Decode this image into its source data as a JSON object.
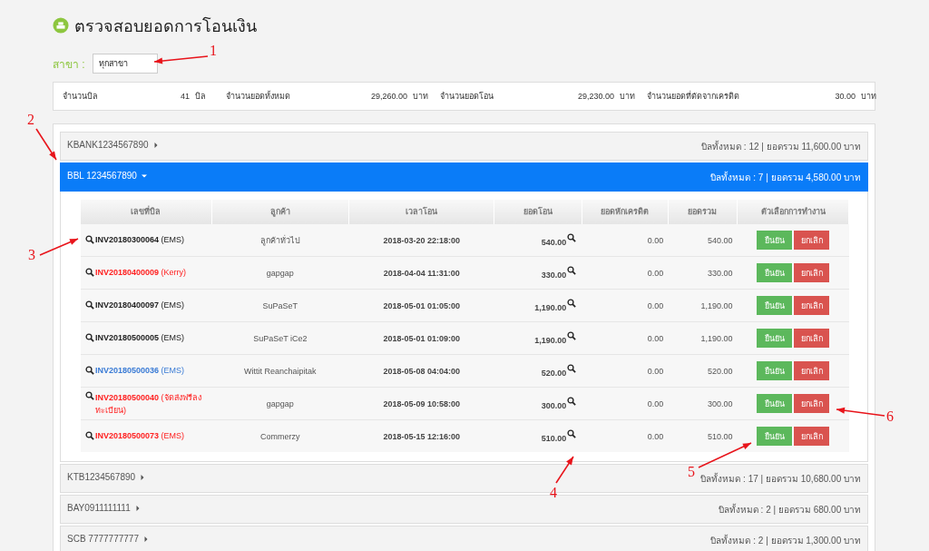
{
  "page": {
    "title": "ตรวจสอบยอดการโอนเงิน"
  },
  "branch": {
    "label": "สาขา :",
    "value": "ทุกสาขา"
  },
  "summary": [
    {
      "label": "จำนวนบิล",
      "value": "41",
      "unit": "บิล"
    },
    {
      "label": "จำนวนยอดทั้งหมด",
      "value": "29,260.00",
      "unit": "บาท"
    },
    {
      "label": "จำนวนยอดโอน",
      "value": "29,230.00",
      "unit": "บาท"
    },
    {
      "label": "จำนวนยอดที่ตัดจากเครดิต",
      "value": "30.00",
      "unit": "บาท"
    }
  ],
  "accounts": [
    {
      "name": "KBANK1234567890",
      "expanded": false,
      "totals": "บิลทั้งหมด : 12 | ยอดรวม 11,600.00 บาท"
    },
    {
      "name": "BBL 1234567890",
      "expanded": true,
      "totals": "บิลทั้งหมด : 7 | ยอดรวม 4,580.00 บาท",
      "table": {
        "columns": [
          "เลขที่บิล",
          "ลูกค้า",
          "เวลาโอน",
          "ยอดโอน",
          "ยอดหักเครดิต",
          "ยอดรวม",
          "ตัวเลือกการทำงาน"
        ],
        "rows": [
          {
            "bill": "**INV20180300064** (EMS)",
            "color": "#222222",
            "customer": "ลูกค้าทั่วไป",
            "time": "2018-03-20 22:18:00",
            "amount": "540.00",
            "credit": "0.00",
            "total": "540.00",
            "actions": [
              {
                "kind": "confirm",
                "label": "ยืนยัน"
              },
              {
                "kind": "cancel",
                "label": "ยกเลิก"
              }
            ]
          },
          {
            "bill": "**INV20180400009** (Kerry)",
            "color": "#ff2020",
            "customer": "gapgap",
            "time": "2018-04-04 11:31:00",
            "amount": "330.00",
            "credit": "0.00",
            "total": "330.00",
            "actions": [
              {
                "kind": "confirm",
                "label": "ยืนยัน"
              },
              {
                "kind": "cancel",
                "label": "ยกเลิก"
              }
            ]
          },
          {
            "bill": "**INV20180400097** (EMS)",
            "color": "#222222",
            "customer": "SuPaSeT",
            "time": "2018-05-01 01:05:00",
            "amount": "1,190.00",
            "credit": "0.00",
            "total": "1,190.00",
            "actions": [
              {
                "kind": "confirm",
                "label": "ยืนยัน"
              },
              {
                "kind": "cancel",
                "label": "ยกเลิก"
              }
            ]
          },
          {
            "bill": "**INV20180500005** (EMS)",
            "color": "#222222",
            "customer": "SuPaSeT iCe2",
            "time": "2018-05-01 01:09:00",
            "amount": "1,190.00",
            "credit": "0.00",
            "total": "1,190.00",
            "actions": [
              {
                "kind": "confirm",
                "label": "ยืนยัน"
              },
              {
                "kind": "cancel",
                "label": "ยกเลิก"
              }
            ]
          },
          {
            "bill": "**INV20180500036** (EMS)",
            "color": "#3a7bd5",
            "customer": "Wittit Reanchaipitak",
            "time": "2018-05-08 04:04:00",
            "amount": "520.00",
            "credit": "0.00",
            "total": "520.00",
            "actions": [
              {
                "kind": "confirm",
                "label": "ยืนยัน"
              },
              {
                "kind": "cancel",
                "label": "ยกเลิก"
              }
            ]
          },
          {
            "bill": "**INV20180500040** (จัดส่งฟรีลงทะเบียน)",
            "color": "#ff2020",
            "customer": "gapgap",
            "time": "2018-05-09 10:58:00",
            "amount": "300.00",
            "credit": "0.00",
            "total": "300.00",
            "actions": [
              {
                "kind": "confirm",
                "label": "ยืนยัน"
              },
              {
                "kind": "cancel",
                "label": "ยกเลิก"
              }
            ]
          },
          {
            "bill": "**INV20180500073** (EMS)",
            "color": "#ff2020",
            "customer": "Commerzy",
            "time": "2018-05-15 12:16:00",
            "amount": "510.00",
            "credit": "0.00",
            "total": "510.00",
            "actions": [
              {
                "kind": "confirm",
                "label": "ยืนยัน"
              },
              {
                "kind": "cancel",
                "label": "ยกเลิก"
              }
            ]
          }
        ]
      }
    },
    {
      "name": "KTB1234567890",
      "expanded": false,
      "totals": "บิลทั้งหมด : 17 | ยอดรวม 10,680.00 บาท"
    },
    {
      "name": "BAY0911111111",
      "expanded": false,
      "totals": "บิลทั้งหมด : 2 | ยอดรวม 680.00 บาท"
    },
    {
      "name": "SCB 7777777777",
      "expanded": false,
      "totals": "บิลทั้งหมด : 2 | ยอดรวม 1,300.00 บาท"
    }
  ],
  "annotations": [
    {
      "label": "1"
    },
    {
      "label": "2"
    },
    {
      "label": "3"
    },
    {
      "label": "4"
    },
    {
      "label": "5"
    },
    {
      "label": "6"
    }
  ]
}
